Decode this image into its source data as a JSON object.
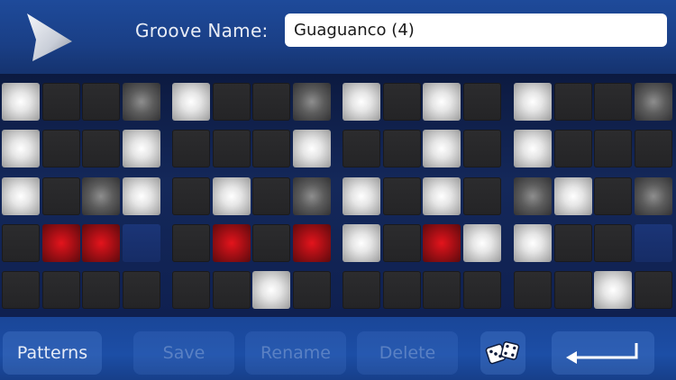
{
  "header": {
    "groove_label": "Groove Name:",
    "groove_value": "Guaguanco (4)"
  },
  "colors": {
    "on": "#ffffff",
    "mid": "#6e6e6e",
    "off": "#2a2a2c",
    "red": "#c8141b",
    "blue": "#1b3577"
  },
  "grid": {
    "rows": [
      [
        "on",
        "off",
        "off",
        "mid",
        "on",
        "off",
        "off",
        "mid",
        "on",
        "off",
        "on",
        "off",
        "on",
        "off",
        "off",
        "mid"
      ],
      [
        "on",
        "off",
        "off",
        "on",
        "off",
        "off",
        "off",
        "on",
        "off",
        "off",
        "on",
        "off",
        "on",
        "off",
        "off",
        "off"
      ],
      [
        "on",
        "off",
        "mid",
        "on",
        "off",
        "on",
        "off",
        "mid",
        "on",
        "off",
        "on",
        "off",
        "mid",
        "on",
        "off",
        "mid"
      ],
      [
        "off",
        "red",
        "red",
        "blue",
        "off",
        "red",
        "off",
        "red",
        "on",
        "off",
        "red",
        "on",
        "on",
        "off",
        "off",
        "blue"
      ],
      [
        "off",
        "off",
        "off",
        "off",
        "off",
        "off",
        "on",
        "off",
        "off",
        "off",
        "off",
        "off",
        "off",
        "off",
        "on",
        "off"
      ]
    ]
  },
  "footer": {
    "patterns_label": "Patterns",
    "save_label": "Save",
    "rename_label": "Rename",
    "delete_label": "Delete",
    "dice_icon": "dice-icon",
    "enter_icon": "return-arrow-icon"
  }
}
